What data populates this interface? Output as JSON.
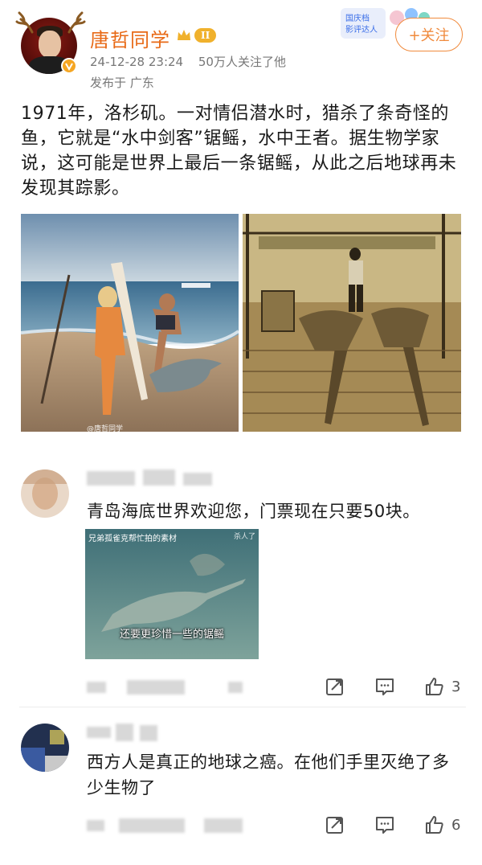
{
  "post": {
    "author": {
      "name": "唐哲同学",
      "rank_level": "II"
    },
    "timestamp": "24-12-28 23:24",
    "followers": "50万人关注了他",
    "location": "发布于 广东",
    "follow_label": "+关注",
    "promo_badge_text": "国庆档影评达人",
    "text": "1971年，洛杉矶。一对情侣潜水时，猎杀了条奇怪的鱼，它就是“水中剑客”锯鳐，水中王者。据生物学家说，这可能是世界上最后一条锯鳐，从此之后地球再未发现其踪影。",
    "image_watermark": "@唐哲同学"
  },
  "comments": [
    {
      "text": "青岛海底世界欢迎您，门票现在只要50块。",
      "media": {
        "caption_top": "兄弟孤雀克帮忙拍的素材",
        "corner_text": "杀人了",
        "subtitle": "还要更珍惜一些的锯鳐"
      },
      "likes": "3"
    },
    {
      "text": "西方人是真正的地球之癌。在他们手里灭绝了多少生物了",
      "likes": "6"
    }
  ],
  "icons": {
    "share": "share-icon",
    "comment": "comment-icon",
    "like": "thumbs-up-icon"
  },
  "colors": {
    "username": "#e86a17",
    "follow_accent": "#f08a3c",
    "meta_gray": "#777777"
  }
}
